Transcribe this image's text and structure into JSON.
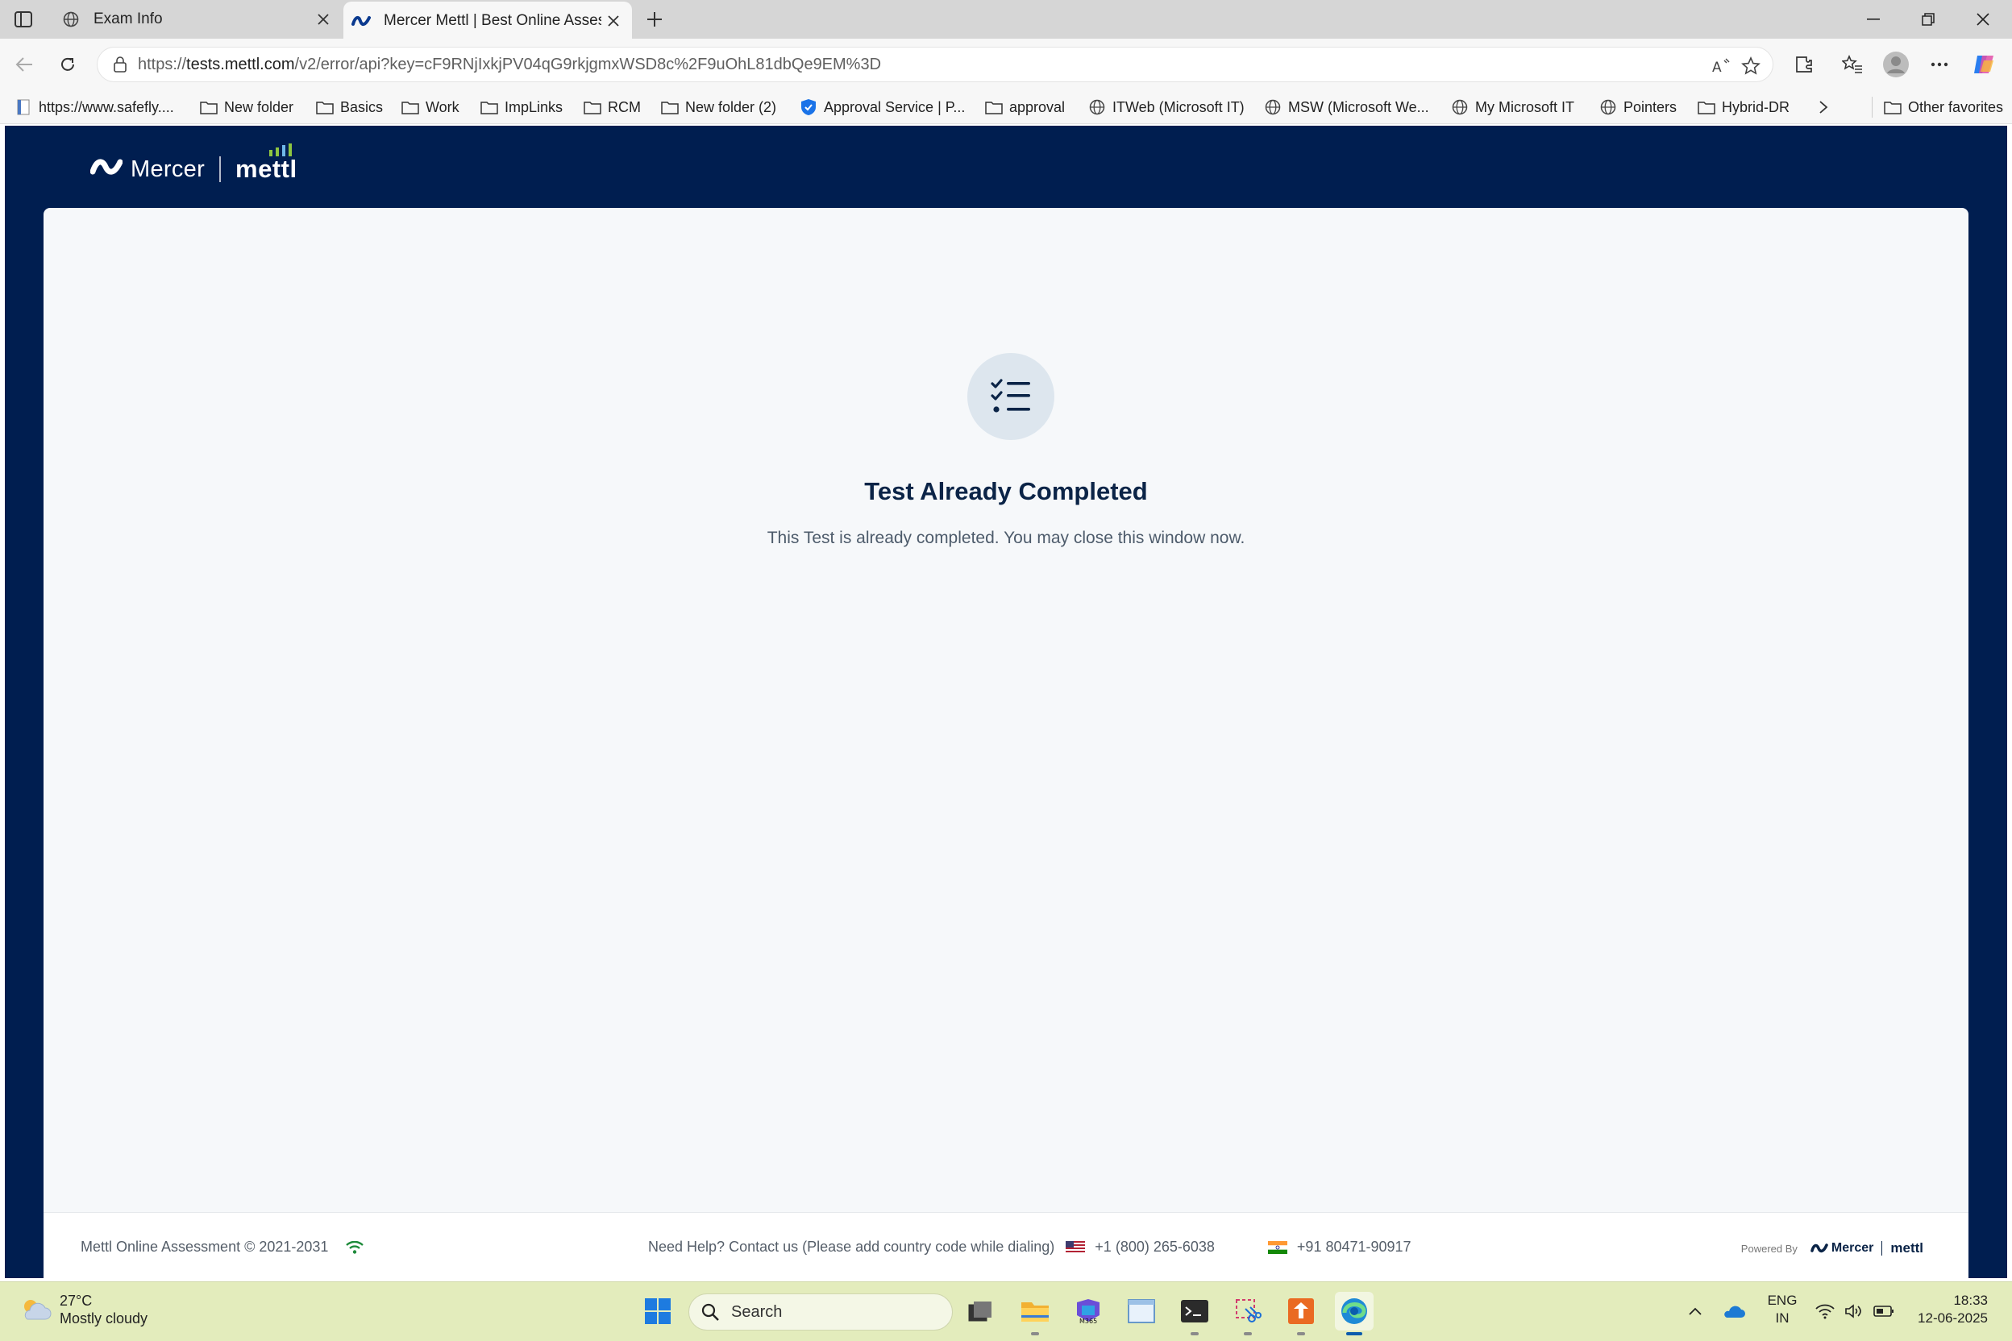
{
  "browser": {
    "tabs": [
      {
        "label": "Exam Info",
        "icon": "globe-icon"
      },
      {
        "label": "Mercer Mettl | Best Online Assess",
        "icon": "mercer-logo-icon"
      }
    ],
    "url_domain": "tests.mettl.com",
    "url_prefix": "https://",
    "url_path": "/v2/error/api?key=cF9RNjIxkjPV04qG9rkjgmxWSD8c%2F9uOhL81dbQe9EM%3D",
    "bookmarks": [
      {
        "label": "https://www.safefly....",
        "icon": "page-icon"
      },
      {
        "label": "New folder",
        "icon": "folder-icon"
      },
      {
        "label": "Basics",
        "icon": "folder-icon"
      },
      {
        "label": "Work",
        "icon": "folder-icon"
      },
      {
        "label": "ImpLinks",
        "icon": "folder-icon"
      },
      {
        "label": "RCM",
        "icon": "folder-icon"
      },
      {
        "label": "New folder (2)",
        "icon": "folder-icon"
      },
      {
        "label": "Approval Service | P...",
        "icon": "shield-icon"
      },
      {
        "label": "approval",
        "icon": "folder-icon"
      },
      {
        "label": "ITWeb (Microsoft IT)",
        "icon": "globe-icon"
      },
      {
        "label": "MSW (Microsoft We...",
        "icon": "globe-icon"
      },
      {
        "label": "My Microsoft IT",
        "icon": "globe-icon"
      },
      {
        "label": "Pointers",
        "icon": "globe-icon"
      },
      {
        "label": "Hybrid-DR",
        "icon": "folder-icon"
      }
    ],
    "other_favorites": "Other favorites"
  },
  "page": {
    "brand_mercer": "Mercer",
    "brand_mettl": "mettl",
    "heading": "Test Already Completed",
    "message": "This Test is already completed. You may close this window now.",
    "footer": {
      "copyright": "Mettl Online Assessment © 2021-2031",
      "help": "Need Help? Contact us (Please add country code while dialing)",
      "phone_us": "+1 (800) 265-6038",
      "phone_in": "+91 80471-90917",
      "powered_by": "Powered By",
      "pow_mercer": "Mercer",
      "pow_mettl": "mettl"
    }
  },
  "taskbar": {
    "temperature": "27°C",
    "weather": "Mostly cloudy",
    "search_placeholder": "Search",
    "lang_top": "ENG",
    "lang_bottom": "IN",
    "time": "18:33",
    "date": "12-06-2025"
  },
  "colors": {
    "page_header_bg": "#001e50",
    "card_bg": "#f6f8fa",
    "heading": "#0b2447",
    "taskbar_bg": "#e3ecbc",
    "mettl_accent": "#8ec641"
  }
}
